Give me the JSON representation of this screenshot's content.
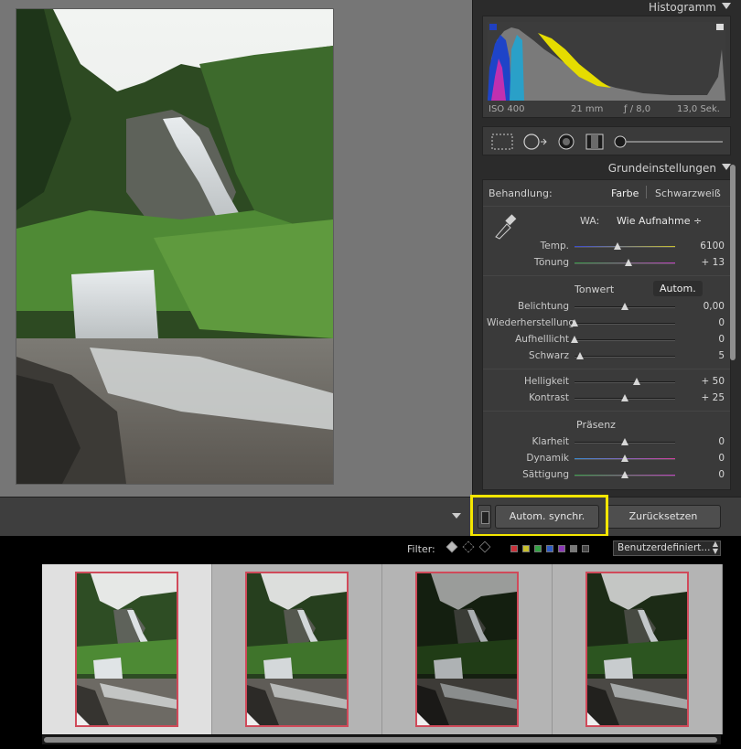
{
  "histogram": {
    "title": "Histogramm",
    "iso": "ISO 400",
    "focal": "21 mm",
    "aperture": "ƒ / 8,0",
    "shutter": "13,0 Sek."
  },
  "basic": {
    "title": "Grundeinstellungen",
    "treatment_label": "Behandlung:",
    "treatment_color": "Farbe",
    "treatment_bw": "Schwarzweiß",
    "wb_label": "WA:",
    "wb_value": "Wie Aufnahme ÷",
    "sliders_wb": [
      {
        "label": "Temp.",
        "value": "6100",
        "pos": 0.43
      },
      {
        "label": "Tönung",
        "value": "+ 13",
        "pos": 0.54
      }
    ],
    "tone_label": "Tonwert",
    "auto_label": "Autom.",
    "sliders_tone": [
      {
        "label": "Belichtung",
        "value": "0,00",
        "pos": 0.5
      },
      {
        "label": "Wiederherstellung",
        "value": "0",
        "pos": 0.0
      },
      {
        "label": "Aufhelllicht",
        "value": "0",
        "pos": 0.0
      },
      {
        "label": "Schwarz",
        "value": "5",
        "pos": 0.05
      }
    ],
    "sliders_bc": [
      {
        "label": "Helligkeit",
        "value": "+ 50",
        "pos": 0.62
      },
      {
        "label": "Kontrast",
        "value": "+ 25",
        "pos": 0.5
      }
    ],
    "presence_label": "Präsenz",
    "sliders_presence": [
      {
        "label": "Klarheit",
        "value": "0",
        "pos": 0.5
      },
      {
        "label": "Dynamik",
        "value": "0",
        "pos": 0.5
      },
      {
        "label": "Sättigung",
        "value": "0",
        "pos": 0.5
      }
    ]
  },
  "bottom": {
    "sync_label": "Autom. synchr.",
    "reset_label": "Zurücksetzen"
  },
  "filter": {
    "label": "Filter:",
    "preset": "Benutzerdefiniert..."
  },
  "colors": {
    "highlight": "#f4e600",
    "thumb_border": "#d04a5a"
  }
}
